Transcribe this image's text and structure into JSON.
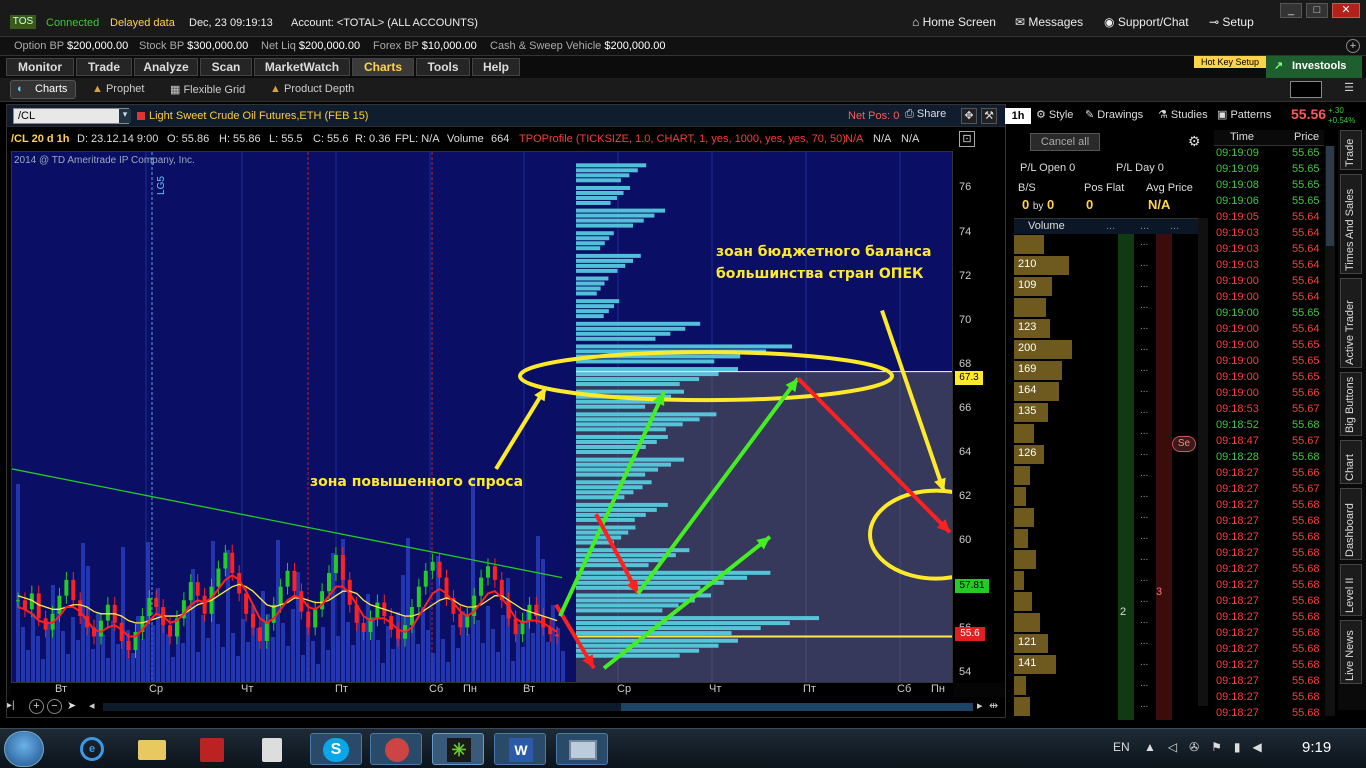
{
  "status": {
    "logo": "TOS",
    "connected": "Connected",
    "delayed": "Delayed data",
    "datetime": "Dec, 23  09:19:13",
    "account": "Account: <TOTAL> (ALL ACCOUNTS)"
  },
  "top_nav": {
    "home": "Home Screen",
    "messages": "Messages",
    "support": "Support/Chat",
    "setup": "Setup"
  },
  "balances": [
    {
      "label": "Option BP",
      "value": "$200,000.00"
    },
    {
      "label": "Stock BP",
      "value": "$300,000.00"
    },
    {
      "label": "Net Liq",
      "value": "$200,000.00"
    },
    {
      "label": "Forex BP",
      "value": "$10,000.00"
    },
    {
      "label": "Cash & Sweep Vehicle",
      "value": "$200,000.00"
    }
  ],
  "main_tabs": [
    "Monitor",
    "Trade",
    "Analyze",
    "Scan",
    "MarketWatch",
    "Charts",
    "Tools",
    "Help"
  ],
  "active_tab": "Charts",
  "hotkey": "Hot Key Setup",
  "investools": "Investools",
  "sub_tabs": {
    "charts": "Charts",
    "prophet": "Prophet",
    "flexible": "Flexible Grid",
    "depth": "Product Depth"
  },
  "chart_bar": {
    "symbol": "/CL",
    "description": "Light Sweet Crude Oil Futures,ETH (FEB 15)",
    "netpos": "Net Pos: 0",
    "share": "Share",
    "period": "1h",
    "style": "Style",
    "drawings": "Drawings",
    "studies": "Studies",
    "patterns": "Patterns",
    "last": "55.56",
    "change": "+.30",
    "change_pct": "+0.54%"
  },
  "info_bar": {
    "title": "/CL 20 d 1h",
    "d": "D: 23.12.14 9:00",
    "o": "O: 55.86",
    "h": "H: 55.86",
    "l": "L: 55.5",
    "c": "C: 55.6",
    "r": "R: 0.36",
    "fpl": "FPL: N/A",
    "volume_label": "Volume",
    "volume": "664",
    "tpo": "TPOProfile (TICKSIZE, 1.0, CHART, 1, yes, 1000, yes, yes, 70, 50)",
    "na1": "N/A",
    "na2": "N/A",
    "na3": "N/A"
  },
  "copyright": "2014 @ TD Ameritrade IP Company, Inc.",
  "event_marker": "LG5",
  "annotations": {
    "opec": "зоан бюджетного баланса",
    "opec2": "большинства стран ОПЕК",
    "demand": "зона повышенного спроса"
  },
  "y_ticks": [
    "76",
    "74",
    "72",
    "70",
    "68",
    "66",
    "64",
    "62",
    "60",
    "58",
    "56",
    "54"
  ],
  "price_tags": {
    "level_high": "67.3",
    "level_mid": "57.81",
    "last": "55.6"
  },
  "x_ticks": [
    "Вт",
    "Ср",
    "Чт",
    "Пт",
    "Сб",
    "Пн",
    "Вт",
    "Ср",
    "Чт",
    "Пт",
    "Сб",
    "Пн"
  ],
  "colors": {
    "plot_bg": "#0a0e64",
    "ma_red": "#ff2020",
    "ma_yellow": "#ffe94a",
    "ma_green": "#22cc22",
    "tpo": "#5ad4e6",
    "anno": "#ffea2a"
  },
  "chart_data": {
    "type": "candlestick",
    "ylim": [
      53.5,
      77
    ],
    "closes": [
      57.2,
      56.8,
      57.5,
      56.4,
      55.9,
      56.6,
      57.4,
      58.1,
      57.2,
      56.5,
      56.0,
      55.6,
      56.3,
      57.0,
      56.2,
      55.4,
      55.0,
      55.8,
      56.5,
      57.3,
      56.9,
      56.1,
      55.6,
      56.4,
      57.2,
      58.0,
      57.4,
      56.6,
      57.8,
      58.6,
      59.3,
      58.4,
      57.5,
      56.6,
      56.0,
      55.4,
      56.2,
      57.0,
      57.8,
      58.5,
      57.6,
      56.7,
      56.0,
      56.8,
      57.6,
      58.4,
      59.2,
      58.1,
      57.0,
      56.2,
      55.8,
      56.4,
      57.1,
      56.5,
      55.9,
      55.5,
      56.1,
      56.9,
      57.8,
      58.5,
      58.9,
      58.2,
      57.3,
      56.6,
      56.0,
      56.5,
      57.4,
      58.2,
      58.7,
      58.1,
      57.2,
      56.4,
      55.7,
      56.3,
      57.0,
      56.5,
      56.0,
      55.7,
      55.6
    ],
    "ma_red": [
      56.9,
      56.8,
      56.6,
      56.3,
      56.2,
      56.2,
      56.5,
      56.9,
      56.9,
      56.7,
      56.3,
      55.9,
      55.8,
      56.0,
      56.1,
      55.9,
      55.6,
      55.6,
      55.9,
      56.3,
      56.6,
      56.5,
      56.2,
      56.3,
      56.6,
      57.0,
      57.2,
      57.1,
      57.3,
      57.7,
      58.1,
      58.3,
      58.1,
      57.6,
      57.0,
      56.4,
      56.2,
      56.4,
      56.8,
      57.2,
      57.4,
      57.3,
      56.9,
      56.8,
      57.0,
      57.4,
      57.8,
      57.8,
      57.5,
      57.0,
      56.5,
      56.3,
      56.4,
      56.4,
      56.2,
      55.9,
      55.8,
      56.0,
      56.5,
      57.0,
      57.5,
      57.7,
      57.5,
      57.1,
      56.7,
      56.5,
      56.7,
      57.1,
      57.5,
      57.6,
      57.3,
      56.9,
      56.4,
      56.2,
      56.3,
      56.3,
      56.2,
      56.0,
      55.8
    ],
    "ma_yellow": [
      57.4,
      57.3,
      57.2,
      57.0,
      56.9,
      56.8,
      56.8,
      56.9,
      57.0,
      57.0,
      56.9,
      56.7,
      56.6,
      56.6,
      56.6,
      56.5,
      56.3,
      56.2,
      56.2,
      56.3,
      56.4,
      56.5,
      56.5,
      56.5,
      56.6,
      56.8,
      57.0,
      57.1,
      57.2,
      57.4,
      57.6,
      57.8,
      57.9,
      57.8,
      57.6,
      57.3,
      57.0,
      56.9,
      57.0,
      57.1,
      57.3,
      57.3,
      57.2,
      57.1,
      57.1,
      57.2,
      57.4,
      57.6,
      57.6,
      57.5,
      57.2,
      57.0,
      56.9,
      56.8,
      56.7,
      56.6,
      56.5,
      56.5,
      56.6,
      56.8,
      57.0,
      57.2,
      57.3,
      57.2,
      57.0,
      56.9,
      56.9,
      57.0,
      57.2,
      57.4,
      57.4,
      57.2,
      57.0,
      56.8,
      56.7,
      56.6,
      56.5,
      56.4,
      56.3
    ],
    "ma_green_start": 63.0,
    "ma_green_end": 58.2,
    "profile_levels": [
      76,
      75,
      74,
      73,
      72,
      71,
      70,
      69,
      68,
      67,
      66,
      65,
      64,
      63,
      62,
      61,
      60,
      59,
      58,
      57,
      56,
      55
    ],
    "profile_widths": [
      0.26,
      0.2,
      0.33,
      0.14,
      0.24,
      0.12,
      0.16,
      0.46,
      0.8,
      0.6,
      0.4,
      0.52,
      0.34,
      0.4,
      0.28,
      0.34,
      0.22,
      0.42,
      0.72,
      0.5,
      0.9,
      0.6
    ]
  },
  "order_panel": {
    "cancel": "Cancel all",
    "pl_open": "P/L Open 0",
    "pl_day": "P/L Day 0",
    "bs": "B/S",
    "pos_flat": "Pos Flat",
    "avg_price": "Avg Price",
    "bs_val": "0",
    "by": "by",
    "bs_val2": "0",
    "pos_val": "0",
    "avg_val": "N/A",
    "volume_header": "Volume",
    "dots": "...",
    "bubble": "Se"
  },
  "volume_rows": [
    {
      "label": "",
      "w": 0.3
    },
    {
      "label": "210",
      "w": 0.55
    },
    {
      "label": "109",
      "w": 0.38
    },
    {
      "label": "",
      "w": 0.32
    },
    {
      "label": "123",
      "w": 0.36
    },
    {
      "label": "200",
      "w": 0.58
    },
    {
      "label": "169",
      "w": 0.48
    },
    {
      "label": "164",
      "w": 0.45
    },
    {
      "label": "135",
      "w": 0.34
    },
    {
      "label": "",
      "w": 0.2
    },
    {
      "label": "126",
      "w": 0.3
    },
    {
      "label": "",
      "w": 0.16
    },
    {
      "label": "",
      "w": 0.12
    },
    {
      "label": "",
      "w": 0.2
    },
    {
      "label": "",
      "w": 0.14
    },
    {
      "label": "",
      "w": 0.22
    },
    {
      "label": "",
      "w": 0.1
    },
    {
      "label": "",
      "w": 0.18
    },
    {
      "label": "",
      "w": 0.26
    },
    {
      "label": "121",
      "w": 0.34
    },
    {
      "label": "141",
      "w": 0.42
    },
    {
      "label": "",
      "w": 0.12
    },
    {
      "label": "",
      "w": 0.16
    }
  ],
  "side_numbers": {
    "bid": "2",
    "ask": "3"
  },
  "tns": {
    "time_header": "Time",
    "price_header": "Price",
    "rows": [
      [
        "09:19:09",
        "55.65",
        "g"
      ],
      [
        "09:19:09",
        "55.65",
        "g"
      ],
      [
        "09:19:08",
        "55.65",
        "g"
      ],
      [
        "09:19:06",
        "55.65",
        "g"
      ],
      [
        "09:19:05",
        "55.64",
        "r"
      ],
      [
        "09:19:03",
        "55.64",
        "r"
      ],
      [
        "09:19:03",
        "55.64",
        "r"
      ],
      [
        "09:19:03",
        "55.64",
        "r"
      ],
      [
        "09:19:00",
        "55.64",
        "r"
      ],
      [
        "09:19:00",
        "55.64",
        "r"
      ],
      [
        "09:19:00",
        "55.65",
        "g"
      ],
      [
        "09:19:00",
        "55.64",
        "r"
      ],
      [
        "09:19:00",
        "55.65",
        "r"
      ],
      [
        "09:19:00",
        "55.65",
        "r"
      ],
      [
        "09:19:00",
        "55.65",
        "r"
      ],
      [
        "09:19:00",
        "55.66",
        "r"
      ],
      [
        "09:18:53",
        "55.67",
        "r"
      ],
      [
        "09:18:52",
        "55.68",
        "g"
      ],
      [
        "09:18:47",
        "55.67",
        "r"
      ],
      [
        "09:18:28",
        "55.68",
        "g"
      ],
      [
        "09:18:27",
        "55.66",
        "r"
      ],
      [
        "09:18:27",
        "55.67",
        "r"
      ],
      [
        "09:18:27",
        "55.68",
        "r"
      ],
      [
        "09:18:27",
        "55.68",
        "r"
      ],
      [
        "09:18:27",
        "55.68",
        "r"
      ],
      [
        "09:18:27",
        "55.68",
        "r"
      ],
      [
        "09:18:27",
        "55.68",
        "r"
      ],
      [
        "09:18:27",
        "55.68",
        "r"
      ],
      [
        "09:18:27",
        "55.68",
        "r"
      ],
      [
        "09:18:27",
        "55.68",
        "r"
      ],
      [
        "09:18:27",
        "55.68",
        "r"
      ],
      [
        "09:18:27",
        "55.68",
        "r"
      ],
      [
        "09:18:27",
        "55.68",
        "r"
      ],
      [
        "09:18:27",
        "55.68",
        "r"
      ],
      [
        "09:18:27",
        "55.68",
        "r"
      ],
      [
        "09:18:27",
        "55.68",
        "r"
      ],
      [
        "09:18:27",
        "55.68",
        "r"
      ]
    ]
  },
  "vertical_tabs": [
    "Trade",
    "Times And Sales",
    "Active Trader",
    "Big Buttons",
    "Chart",
    "Dashboard",
    "Level II",
    "Live News"
  ],
  "taskbar": {
    "lang": "EN",
    "clock": "9:19"
  }
}
